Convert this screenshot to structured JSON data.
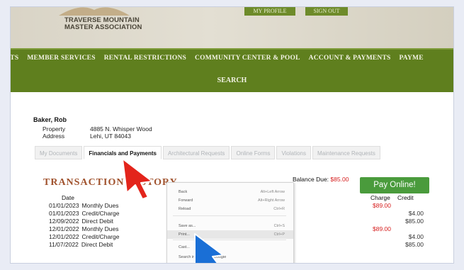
{
  "header": {
    "association_line1": "TRAVERSE MOUNTAIN",
    "association_line2": "MASTER ASSOCIATION",
    "my_profile": "MY PROFILE",
    "sign_out": "SIGN OUT"
  },
  "nav": {
    "items": [
      "EMENTS",
      "MEMBER SERVICES",
      "RENTAL RESTRICTIONS",
      "COMMUNITY CENTER & POOL",
      "ACCOUNT & PAYMENTS",
      "PAYME"
    ],
    "search": "SEARCH"
  },
  "owner": {
    "name": "Baker, Rob",
    "property_label": "Property",
    "property_value": "4885 N. Whisper Wood",
    "address_label": "Address",
    "address_value": "Lehi, UT 84043"
  },
  "tabs": [
    "My Documents",
    "Financials and Payments",
    "Architectural Requests",
    "Online Forms",
    "Violations",
    "Maintenance Requests"
  ],
  "transactions": {
    "title": "TRANSACTION HISTORY",
    "balance_label": "Balance Due:",
    "balance_value": "$85.00",
    "pay_button": "Pay Online!",
    "col_date": "Date",
    "col_charge": "Charge",
    "col_credit": "Credit",
    "rows": [
      {
        "date": "01/01/2023",
        "desc": "Monthly Dues",
        "charge": "$89.00",
        "credit": ""
      },
      {
        "date": "01/01/2023",
        "desc": "Credit/Charge",
        "charge": "",
        "credit": "$4.00"
      },
      {
        "date": "12/09/2022",
        "desc": "Direct Debit",
        "charge": "",
        "credit": "$85.00"
      },
      {
        "date": "12/01/2022",
        "desc": "Monthly Dues",
        "charge": "$89.00",
        "credit": ""
      },
      {
        "date": "12/01/2022",
        "desc": "Credit/Charge",
        "charge": "",
        "credit": "$4.00"
      },
      {
        "date": "11/07/2022",
        "desc": "Direct Debit",
        "charge": "",
        "credit": "$85.00"
      }
    ]
  },
  "context_menu": {
    "items": [
      {
        "label": "Back",
        "shortcut": "Alt+Left Arrow"
      },
      {
        "label": "Forward",
        "shortcut": "Alt+Right Arrow"
      },
      {
        "label": "Reload",
        "shortcut": "Ctrl+R"
      },
      {
        "label": "Save as...",
        "shortcut": "Ctrl+S"
      },
      {
        "label": "Print...",
        "shortcut": "Ctrl+P"
      },
      {
        "label": "Cast...",
        "shortcut": ""
      },
      {
        "label": "Search images with Google",
        "shortcut": ""
      }
    ]
  },
  "colors": {
    "nav_green": "#5f7f1e",
    "title_brown": "#a0522d",
    "pay_green": "#4a9b3c",
    "charge_red": "#d62020",
    "cursor_red": "#e3241b",
    "cursor_blue": "#1a6fd6"
  }
}
